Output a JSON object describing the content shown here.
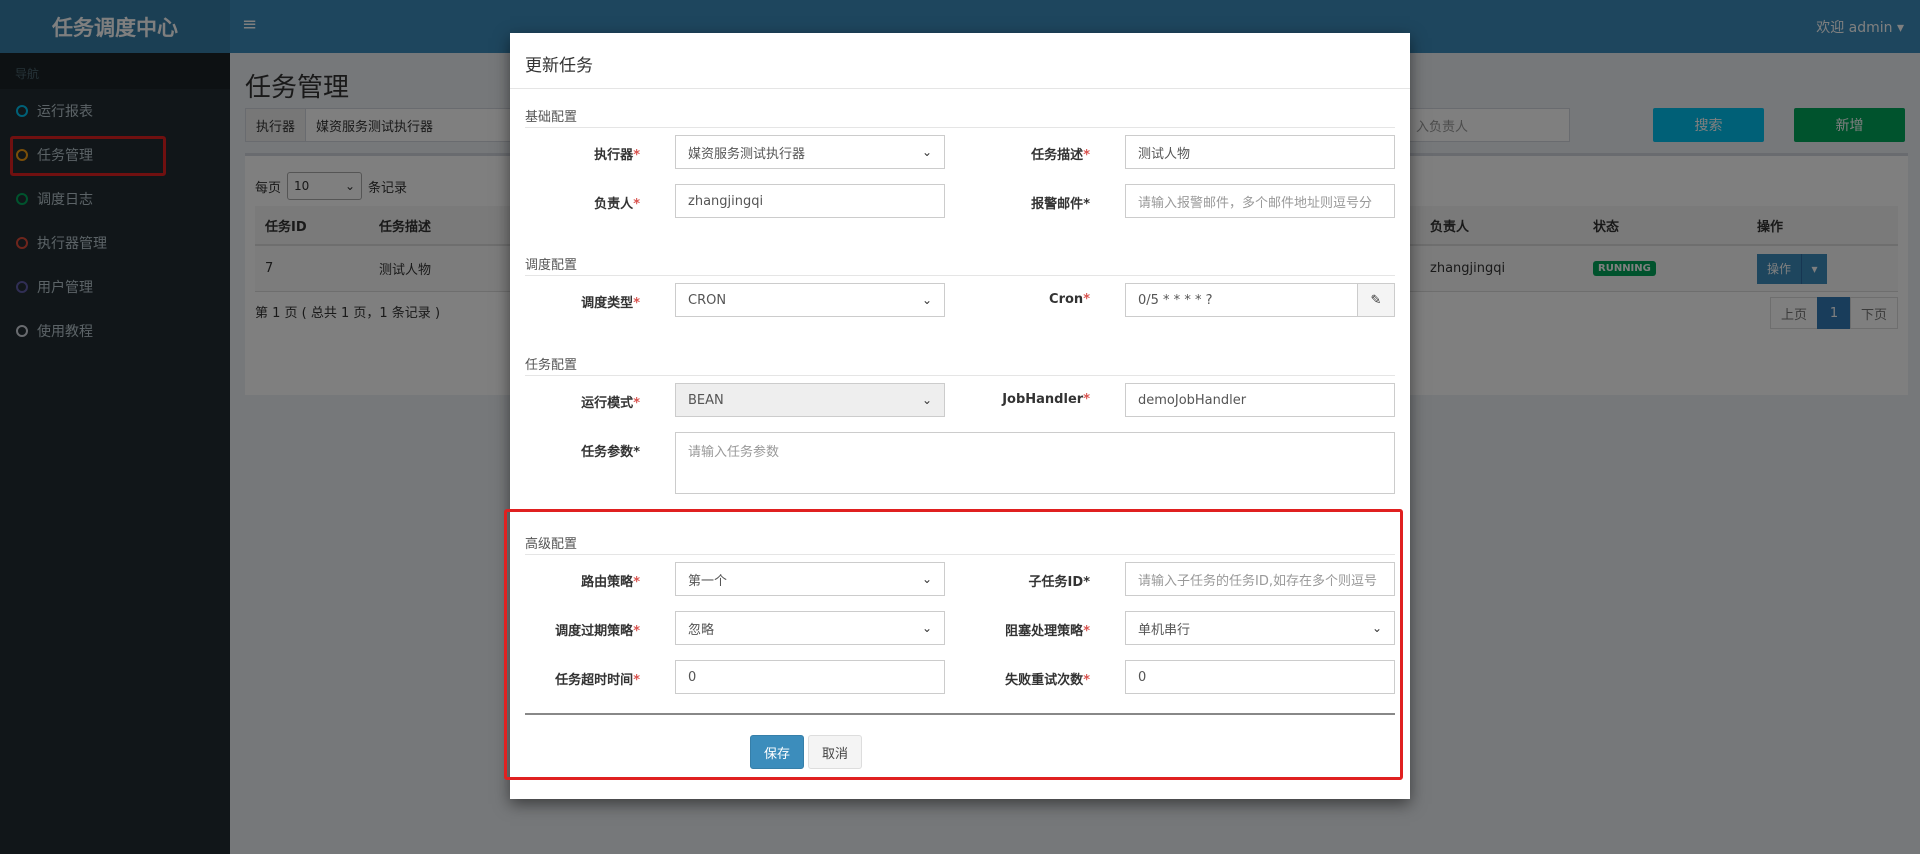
{
  "header": {
    "brand": "任务调度中心",
    "menu_icon": "≡",
    "user": "欢迎 admin ▾"
  },
  "sidebar": {
    "nav_header": "导航",
    "items": [
      {
        "label": "运行报表",
        "color": "#00c0ef"
      },
      {
        "label": "任务管理",
        "color": "#f39c12"
      },
      {
        "label": "调度日志",
        "color": "#00a65a"
      },
      {
        "label": "执行器管理",
        "color": "#dd4b39"
      },
      {
        "label": "用户管理",
        "color": "#605ca8"
      },
      {
        "label": "使用教程",
        "color": "#d2d6de"
      }
    ]
  },
  "main": {
    "title": "任务管理",
    "filter": {
      "executor_label": "执行器",
      "executor_value": "媒资服务测试执行器",
      "owner_placeholder": "入负责人"
    },
    "search_button": "搜索",
    "add_button": "新增",
    "page_size": {
      "prefix": "每页",
      "value": "10",
      "suffix": "条记录"
    },
    "table": {
      "headers": [
        "任务ID",
        "任务描述",
        "负责人",
        "状态",
        "操作"
      ],
      "rows": [
        {
          "id": "7",
          "desc": "测试人物",
          "owner": "zhangjingqi",
          "status": "RUNNING",
          "op": "操作"
        }
      ]
    },
    "pager_info": "第 1 页 ( 总共 1 页，1 条记录 )",
    "pager": {
      "prev": "上页",
      "current": "1",
      "next": "下页"
    }
  },
  "modal": {
    "title": "更新任务",
    "sections": {
      "basic": "基础配置",
      "schedule": "调度配置",
      "task": "任务配置",
      "advanced": "高级配置"
    },
    "fields": {
      "executor": {
        "label": "执行器",
        "value": "媒资服务测试执行器"
      },
      "job_desc": {
        "label": "任务描述",
        "value": "测试人物"
      },
      "author": {
        "label": "负责人",
        "value": "zhangjingqi"
      },
      "alarm_email": {
        "label": "报警邮件",
        "placeholder": "请输入报警邮件，多个邮件地址则逗号分"
      },
      "schedule_type": {
        "label": "调度类型",
        "value": "CRON"
      },
      "cron": {
        "label": "Cron",
        "value": "0/5 * * * * ?"
      },
      "glue_type": {
        "label": "运行模式",
        "value": "BEAN"
      },
      "job_handler": {
        "label": "JobHandler",
        "value": "demoJobHandler"
      },
      "job_param": {
        "label": "任务参数",
        "placeholder": "请输入任务参数"
      },
      "route_strategy": {
        "label": "路由策略",
        "value": "第一个"
      },
      "child_job": {
        "label": "子任务ID",
        "placeholder": "请输入子任务的任务ID,如存在多个则逗号"
      },
      "misfire_strategy": {
        "label": "调度过期策略",
        "value": "忽略"
      },
      "block_strategy": {
        "label": "阻塞处理策略",
        "value": "单机串行"
      },
      "timeout": {
        "label": "任务超时时间",
        "value": "0"
      },
      "fail_retry": {
        "label": "失败重试次数",
        "value": "0"
      }
    },
    "save": "保存",
    "cancel": "取消"
  }
}
